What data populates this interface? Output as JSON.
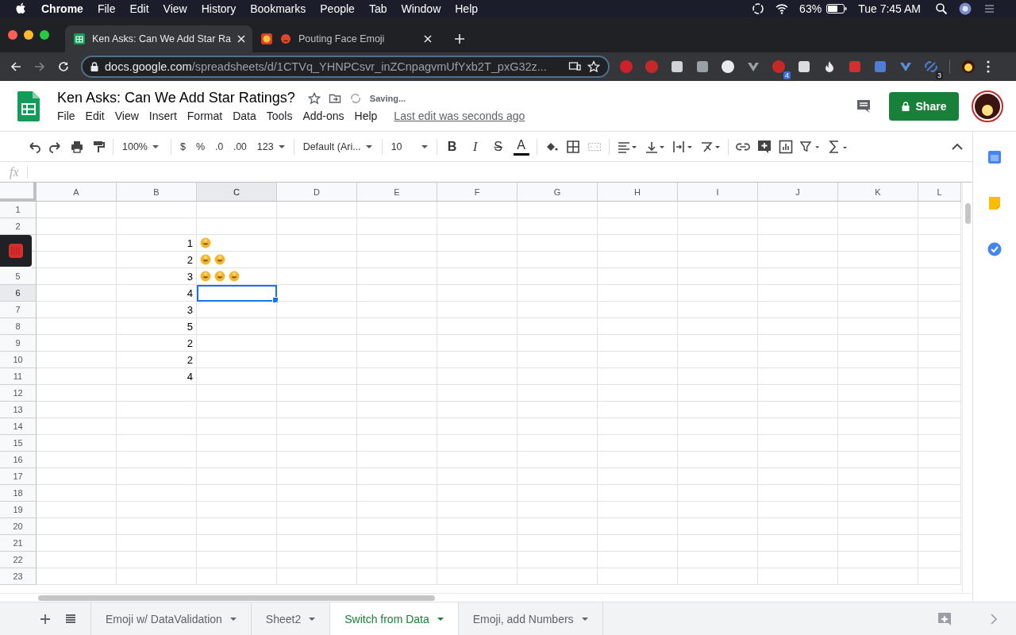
{
  "menu_bar": {
    "app": "Chrome",
    "items": [
      "File",
      "Edit",
      "View",
      "History",
      "Bookmarks",
      "People",
      "Tab",
      "Window",
      "Help"
    ],
    "battery": "63%",
    "clock": "Tue 7:45 AM"
  },
  "browser_tabs": [
    {
      "title": "Ken Asks: Can We Add Star Ra",
      "selected": true
    },
    {
      "title": "Pouting Face Emoji",
      "selected": false
    }
  ],
  "address_bar": {
    "host": "docs.google.com",
    "path": "/spreadsheets/d/1CTVq_YHNPCsvr_inZCnpagvmUfYxb2T_pxG32z..."
  },
  "extension_badges": [
    "4",
    "3"
  ],
  "document": {
    "title": "Ken Asks: Can We Add Star Ratings?",
    "status": "Saving...",
    "menus": [
      "File",
      "Edit",
      "View",
      "Insert",
      "Format",
      "Data",
      "Tools",
      "Add-ons",
      "Help"
    ],
    "last_edit": "Last edit was seconds ago",
    "share": "Share"
  },
  "toolbar": {
    "zoom": "100%",
    "currency": "$",
    "percent": "%",
    "decrease_decimal": ".0",
    "increase_decimal": ".00",
    "number_format": "123",
    "font": "Default (Ari...",
    "font_size": "10",
    "bold": "B",
    "italic": "I",
    "strike": "S",
    "text_color": "A"
  },
  "formula_bar": {
    "label": "fx"
  },
  "columns": [
    {
      "label": "A",
      "selected": false
    },
    {
      "label": "B",
      "selected": false
    },
    {
      "label": "C",
      "selected": true
    },
    {
      "label": "D",
      "selected": false
    },
    {
      "label": "E",
      "selected": false
    },
    {
      "label": "F",
      "selected": false
    },
    {
      "label": "G",
      "selected": false
    },
    {
      "label": "H",
      "selected": false
    },
    {
      "label": "I",
      "selected": false
    },
    {
      "label": "J",
      "selected": false
    },
    {
      "label": "K",
      "selected": false
    },
    {
      "label": "L",
      "selected": false
    }
  ],
  "rows": [
    {
      "header": "1",
      "selected": false
    },
    {
      "header": "2",
      "selected": false
    },
    {
      "selected": false,
      "b": "1",
      "c": [
        {
          "kind": "smiley"
        }
      ]
    },
    {
      "selected": false,
      "b": "2",
      "c": [
        {
          "kind": "smiley"
        },
        {
          "kind": "smiley"
        }
      ]
    },
    {
      "header": "5",
      "selected": false,
      "b": "3",
      "c": [
        {
          "kind": "smiley"
        },
        {
          "kind": "smiley"
        },
        {
          "kind": "smiley"
        }
      ]
    },
    {
      "header": "6",
      "selected": true,
      "b": "4"
    },
    {
      "header": "7",
      "selected": false,
      "b": "3"
    },
    {
      "header": "8",
      "selected": false,
      "b": "5"
    },
    {
      "header": "9",
      "selected": false,
      "b": "2"
    },
    {
      "header": "10",
      "selected": false,
      "b": "2"
    },
    {
      "header": "11",
      "selected": false,
      "b": "4"
    },
    {
      "header": "12",
      "selected": false
    },
    {
      "header": "13",
      "selected": false
    },
    {
      "header": "14",
      "selected": false
    },
    {
      "header": "15",
      "selected": false
    },
    {
      "header": "16",
      "selected": false
    },
    {
      "header": "17",
      "selected": false
    },
    {
      "header": "18",
      "selected": false
    },
    {
      "header": "19",
      "selected": false
    },
    {
      "header": "20",
      "selected": false
    },
    {
      "header": "21",
      "selected": false
    },
    {
      "header": "22",
      "selected": false
    },
    {
      "header": "23",
      "selected": false
    }
  ],
  "sheet_tabs": [
    {
      "label": "Emoji w/ DataValidation",
      "selected": false
    },
    {
      "label": "Sheet2",
      "selected": false
    },
    {
      "label": "Switch from Data",
      "selected": true
    },
    {
      "label": "Emoji, add Numbers",
      "selected": false
    }
  ]
}
